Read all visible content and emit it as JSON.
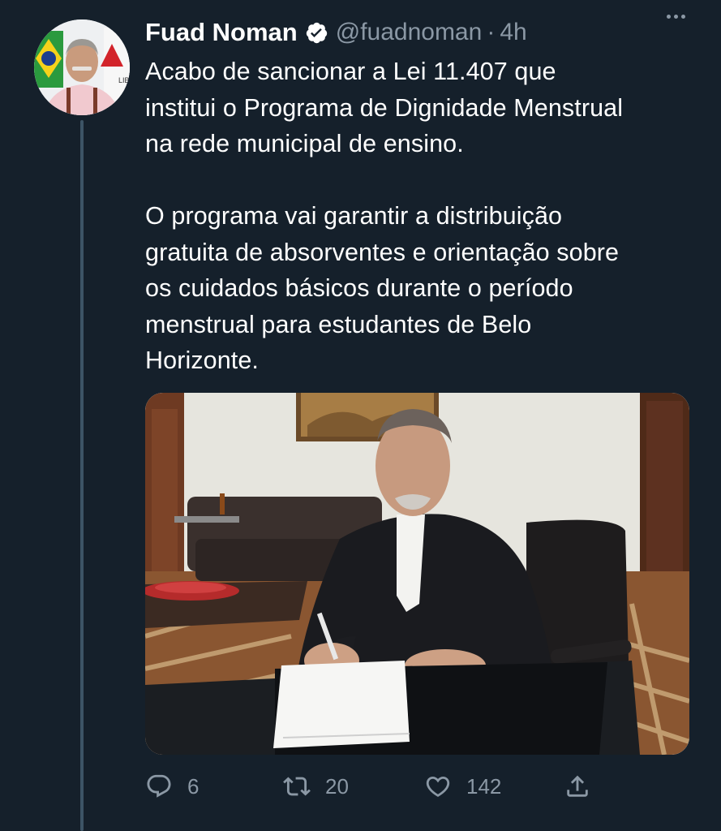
{
  "tweet": {
    "author_name": "Fuad Noman",
    "handle": "@fuadnoman",
    "separator": "·",
    "time": "4h",
    "text": "Acabo de sancionar a Lei 11.407 que\ninstitui o Programa de Dignidade Menstrual\nna rede municipal de ensino.\n\nO programa vai garantir a distribuição\ngratuita de absorventes e orientação sobre\nos cuidados básicos durante o período\nmenstrual para estudantes de Belo\nHorizonte.",
    "avatar_icon": "profile-photo",
    "media_icon": "photo-man-signing-document"
  },
  "actions": {
    "reply_count": "6",
    "retweet_count": "20",
    "like_count": "142"
  },
  "colors": {
    "background": "#15202b",
    "secondary_text": "#8b98a5",
    "thread_line": "#3d5466"
  }
}
